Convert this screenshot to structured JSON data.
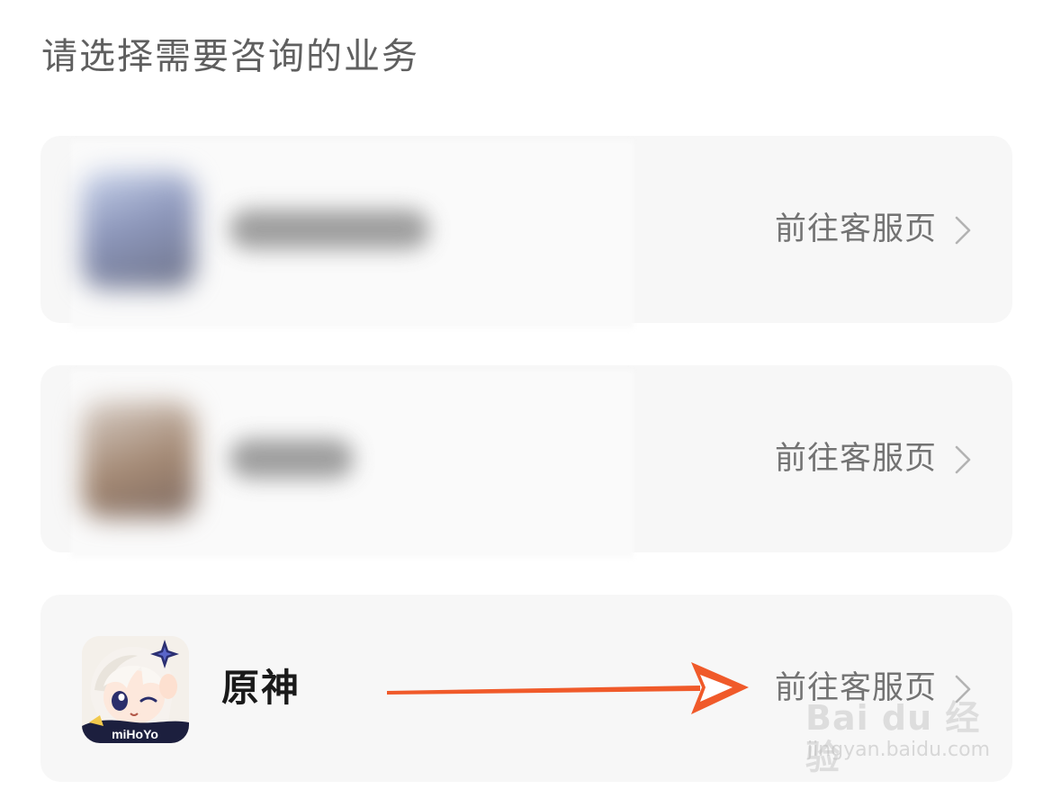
{
  "header": {
    "title": "请选择需要咨询的业务"
  },
  "business_list": [
    {
      "name": "",
      "action_label": "前往客服页",
      "obscured": true,
      "icon": "blurred-app-icon"
    },
    {
      "name": "",
      "action_label": "前往客服页",
      "obscured": true,
      "icon": "blurred-app-icon"
    },
    {
      "name": "原神",
      "action_label": "前往客服页",
      "obscured": false,
      "icon": "genshin-app-icon",
      "icon_text": "miHoYo"
    }
  ],
  "annotation": {
    "type": "arrow",
    "color": "#f05a2a",
    "points_to": "前往客服页"
  },
  "watermark": {
    "logo": "Bai du 经验",
    "url": "jingyan.baidu.com"
  },
  "colors": {
    "card_background": "#f7f7f7",
    "title_text": "#5f5f5f",
    "action_text": "#737373",
    "arrow": "#f05a2a"
  }
}
